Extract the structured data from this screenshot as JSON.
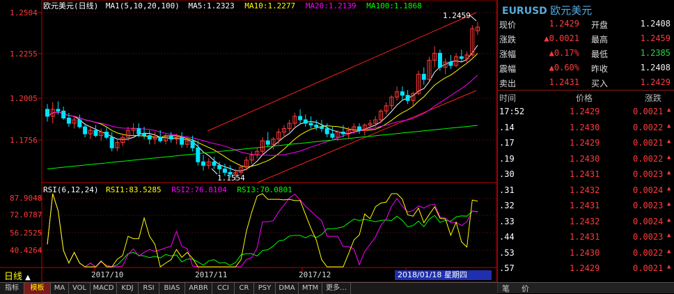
{
  "main_legend": {
    "title": "欧元美元(日线)",
    "ma_params": "MA1(5,10,20,100)",
    "ma5": "MA5:1.2323",
    "ma10": "MA10:1.2277",
    "ma20": "MA20:1.2139",
    "ma100": "MA100:1.1868"
  },
  "rsi_legend": {
    "params": "RSI(6,12,24)",
    "rsi1": "RSI1:83.5285",
    "rsi2": "RSI2:76.8104",
    "rsi3": "RSI3:70.0801"
  },
  "price_axis": [
    "1.2504",
    "1.2255",
    "1.2005",
    "1.1756"
  ],
  "rsi_axis": [
    "87.9048",
    "72.0787",
    "56.2525",
    "40.4264"
  ],
  "x_axis": [
    "2017/10",
    "2017/11",
    "2017/12"
  ],
  "annotations": {
    "high": "1.2459",
    "low": "1.1554"
  },
  "period_label": "日线",
  "period_arrow": "▲",
  "date_box": "2018/01/18 星期四",
  "bottom_tabs": [
    "指标",
    "模板",
    "MA",
    "VOL",
    "MACD",
    "KDJ",
    "RSI",
    "BIAS",
    "ARBR",
    "CCI",
    "CR",
    "PSY",
    "DMA",
    "MTM",
    "更多…"
  ],
  "quote": {
    "symbol": "EURUSD",
    "name": "欧元美元",
    "rows": [
      {
        "l": "现价",
        "v": "1.2429",
        "vc": "red",
        "l2": "开盘",
        "v2": "1.2408",
        "v2c": "white"
      },
      {
        "l": "涨跌",
        "v": "▲0.0021",
        "vc": "red",
        "l2": "最高",
        "v2": "1.2459",
        "v2c": "red"
      },
      {
        "l": "涨幅",
        "v": "▲0.17%",
        "vc": "red",
        "l2": "最低",
        "v2": "1.2385",
        "v2c": "green"
      },
      {
        "l": "震幅",
        "v": "▲0.60%",
        "vc": "red",
        "l2": "昨收",
        "v2": "1.2408",
        "v2c": "white"
      },
      {
        "l": "卖出",
        "v": "1.2431",
        "vc": "red",
        "l2": "买入",
        "v2": "1.2429",
        "v2c": "red"
      }
    ],
    "tick_headers": {
      "time": "时间",
      "price": "价格",
      "change": "涨跌"
    },
    "ticks": [
      {
        "t": "17:52",
        "p": "1.2429",
        "c": "0.0021"
      },
      {
        "t": ".14",
        "p": "1.2430",
        "c": "0.0022"
      },
      {
        "t": ".17",
        "p": "1.2429",
        "c": "0.0021"
      },
      {
        "t": ".19",
        "p": "1.2430",
        "c": "0.0022"
      },
      {
        "t": ".30",
        "p": "1.2431",
        "c": "0.0023"
      },
      {
        "t": ".31",
        "p": "1.2432",
        "c": "0.0024"
      },
      {
        "t": ".32",
        "p": "1.2431",
        "c": "0.0023"
      },
      {
        "t": ".33",
        "p": "1.2432",
        "c": "0.0024"
      },
      {
        "t": ".44",
        "p": "1.2431",
        "c": "0.0023"
      },
      {
        "t": ".53",
        "p": "1.2430",
        "c": "0.0022"
      },
      {
        "t": ".57",
        "p": "1.2429",
        "c": "0.0021"
      }
    ],
    "tick_arrow": "▲",
    "panel_tabs": [
      "笔",
      "价"
    ]
  },
  "colors": {
    "up": "#ff3b3b",
    "down": "#00e5ff",
    "ma5": "#ffffff",
    "ma10": "#ffff00",
    "ma20": "#ff00ff",
    "ma100": "#00ff00",
    "channel": "#ff2020"
  },
  "chart_data": {
    "type": "candlestick",
    "instrument": "EURUSD",
    "period": "daily",
    "ylim": [
      1.155,
      1.252
    ],
    "ohlc": [
      [
        1.196,
        1.199,
        1.189,
        1.192
      ],
      [
        1.192,
        1.2,
        1.188,
        1.196
      ],
      [
        1.196,
        1.2005,
        1.193,
        1.195
      ],
      [
        1.195,
        1.1975,
        1.19,
        1.191
      ],
      [
        1.191,
        1.194,
        1.186,
        1.188
      ],
      [
        1.188,
        1.192,
        1.185,
        1.19
      ],
      [
        1.19,
        1.193,
        1.185,
        1.186
      ],
      [
        1.186,
        1.188,
        1.18,
        1.182
      ],
      [
        1.182,
        1.186,
        1.179,
        1.184
      ],
      [
        1.184,
        1.187,
        1.18,
        1.181
      ],
      [
        1.181,
        1.185,
        1.178,
        1.183
      ],
      [
        1.183,
        1.186,
        1.179,
        1.18
      ],
      [
        1.18,
        1.183,
        1.172,
        1.174
      ],
      [
        1.174,
        1.179,
        1.172,
        1.177
      ],
      [
        1.177,
        1.182,
        1.175,
        1.18
      ],
      [
        1.18,
        1.186,
        1.178,
        1.184
      ],
      [
        1.184,
        1.188,
        1.181,
        1.185
      ],
      [
        1.185,
        1.188,
        1.18,
        1.182
      ],
      [
        1.182,
        1.186,
        1.179,
        1.181
      ],
      [
        1.181,
        1.184,
        1.176,
        1.179
      ],
      [
        1.179,
        1.183,
        1.176,
        1.18
      ],
      [
        1.18,
        1.184,
        1.177,
        1.178
      ],
      [
        1.178,
        1.182,
        1.176,
        1.181
      ],
      [
        1.181,
        1.183,
        1.177,
        1.179
      ],
      [
        1.179,
        1.182,
        1.176,
        1.18
      ],
      [
        1.18,
        1.183,
        1.174,
        1.176
      ],
      [
        1.176,
        1.18,
        1.174,
        1.178
      ],
      [
        1.178,
        1.181,
        1.172,
        1.174
      ],
      [
        1.174,
        1.178,
        1.164,
        1.166
      ],
      [
        1.166,
        1.17,
        1.161,
        1.164
      ],
      [
        1.164,
        1.168,
        1.162,
        1.166
      ],
      [
        1.166,
        1.169,
        1.162,
        1.164
      ],
      [
        1.164,
        1.166,
        1.159,
        1.162
      ],
      [
        1.162,
        1.165,
        1.158,
        1.16
      ],
      [
        1.16,
        1.164,
        1.157,
        1.159
      ],
      [
        1.159,
        1.162,
        1.1554,
        1.16
      ],
      [
        1.16,
        1.164,
        1.158,
        1.163
      ],
      [
        1.163,
        1.169,
        1.161,
        1.167
      ],
      [
        1.167,
        1.172,
        1.165,
        1.17
      ],
      [
        1.17,
        1.174,
        1.168,
        1.172
      ],
      [
        1.172,
        1.18,
        1.17,
        1.178
      ],
      [
        1.178,
        1.183,
        1.175,
        1.176
      ],
      [
        1.176,
        1.18,
        1.173,
        1.179
      ],
      [
        1.179,
        1.185,
        1.176,
        1.183
      ],
      [
        1.183,
        1.187,
        1.18,
        1.185
      ],
      [
        1.185,
        1.19,
        1.183,
        1.188
      ],
      [
        1.188,
        1.194,
        1.186,
        1.192
      ],
      [
        1.192,
        1.196,
        1.188,
        1.19
      ],
      [
        1.19,
        1.193,
        1.186,
        1.188
      ],
      [
        1.188,
        1.192,
        1.185,
        1.187
      ],
      [
        1.187,
        1.19,
        1.184,
        1.186
      ],
      [
        1.186,
        1.19,
        1.183,
        1.185
      ],
      [
        1.185,
        1.188,
        1.18,
        1.182
      ],
      [
        1.182,
        1.186,
        1.179,
        1.18
      ],
      [
        1.18,
        1.184,
        1.178,
        1.183
      ],
      [
        1.183,
        1.187,
        1.18,
        1.182
      ],
      [
        1.182,
        1.186,
        1.179,
        1.184
      ],
      [
        1.184,
        1.188,
        1.182,
        1.186
      ],
      [
        1.186,
        1.188,
        1.182,
        1.184
      ],
      [
        1.184,
        1.188,
        1.181,
        1.187
      ],
      [
        1.187,
        1.19,
        1.184,
        1.188
      ],
      [
        1.188,
        1.192,
        1.186,
        1.19
      ],
      [
        1.19,
        1.196,
        1.188,
        1.195
      ],
      [
        1.195,
        1.2,
        1.193,
        1.198
      ],
      [
        1.198,
        1.204,
        1.196,
        1.203
      ],
      [
        1.203,
        1.209,
        1.201,
        1.206
      ],
      [
        1.206,
        1.209,
        1.201,
        1.204
      ],
      [
        1.204,
        1.207,
        1.199,
        1.201
      ],
      [
        1.201,
        1.206,
        1.198,
        1.205
      ],
      [
        1.205,
        1.218,
        1.204,
        1.216
      ],
      [
        1.216,
        1.22,
        1.21,
        1.213
      ],
      [
        1.213,
        1.226,
        1.212,
        1.224
      ],
      [
        1.224,
        1.232,
        1.22,
        1.228
      ],
      [
        1.228,
        1.23,
        1.218,
        1.22
      ],
      [
        1.22,
        1.225,
        1.216,
        1.223
      ],
      [
        1.223,
        1.227,
        1.219,
        1.221
      ],
      [
        1.221,
        1.228,
        1.22,
        1.226
      ],
      [
        1.226,
        1.23,
        1.223,
        1.225
      ],
      [
        1.225,
        1.229,
        1.222,
        1.227
      ],
      [
        1.227,
        1.244,
        1.226,
        1.242
      ],
      [
        1.2408,
        1.2459,
        1.2385,
        1.2429
      ]
    ],
    "rsi_ylim": [
      30,
      95
    ]
  }
}
